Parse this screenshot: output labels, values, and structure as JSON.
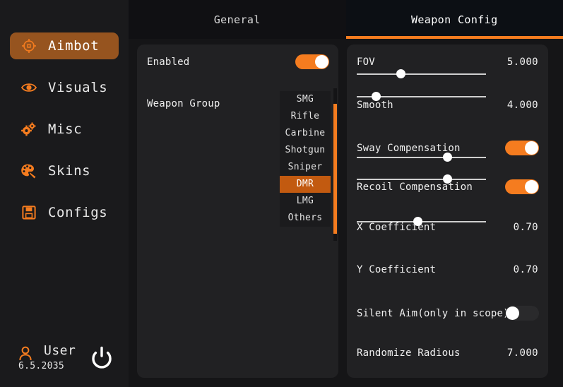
{
  "theme": {
    "accent": "#f57c1f",
    "accent_dim": "#8a4a18",
    "accent_selected": "#c25a10",
    "sidebar_active": "#96541f",
    "panel_bg": "#212123",
    "app_bg": "#151517"
  },
  "sidebar": {
    "items": [
      {
        "label": "Aimbot",
        "icon": "crosshair-icon",
        "active": true
      },
      {
        "label": "Visuals",
        "icon": "eye-icon",
        "active": false
      },
      {
        "label": "Misc",
        "icon": "gears-icon",
        "active": false
      },
      {
        "label": "Skins",
        "icon": "palette-icon",
        "active": false
      },
      {
        "label": "Configs",
        "icon": "floppy-disk-icon",
        "active": false
      }
    ],
    "user": {
      "name": "User",
      "date": "6.5.2035",
      "icon": "user-icon",
      "power_icon": "power-icon"
    }
  },
  "tabs": [
    {
      "label": "General",
      "active": false
    },
    {
      "label": "Weapon Config",
      "active": true
    }
  ],
  "left_panel": {
    "enabled": {
      "label": "Enabled",
      "value": "on"
    },
    "weapon_group": {
      "label": "Weapon Group",
      "selected": "DMR",
      "chevron": "chevron-down-icon",
      "open": true,
      "options": [
        "SMG",
        "Rifle",
        "Carbine",
        "Shotgun",
        "Sniper",
        "DMR",
        "LMG",
        "Others"
      ]
    }
  },
  "right_panel": {
    "fov": {
      "label": "FOV",
      "value": "5.000",
      "pct": 34
    },
    "smooth": {
      "label": "Smooth",
      "value": "4.000",
      "pct": 15
    },
    "sway": {
      "label": "Sway Compensation",
      "value": "on"
    },
    "recoil": {
      "label": "Recoil Compensation",
      "value": "on"
    },
    "x_coef": {
      "label": "X Coefficient",
      "value": "0.70",
      "pct": 70
    },
    "y_coef": {
      "label": "Y Coefficient",
      "value": "0.70",
      "pct": 70
    },
    "silent_aim": {
      "label": "Silent Aim(only in scope)",
      "value": "off"
    },
    "randomize": {
      "label": "Randomize Radious",
      "value": "7.000",
      "pct": 47
    }
  }
}
